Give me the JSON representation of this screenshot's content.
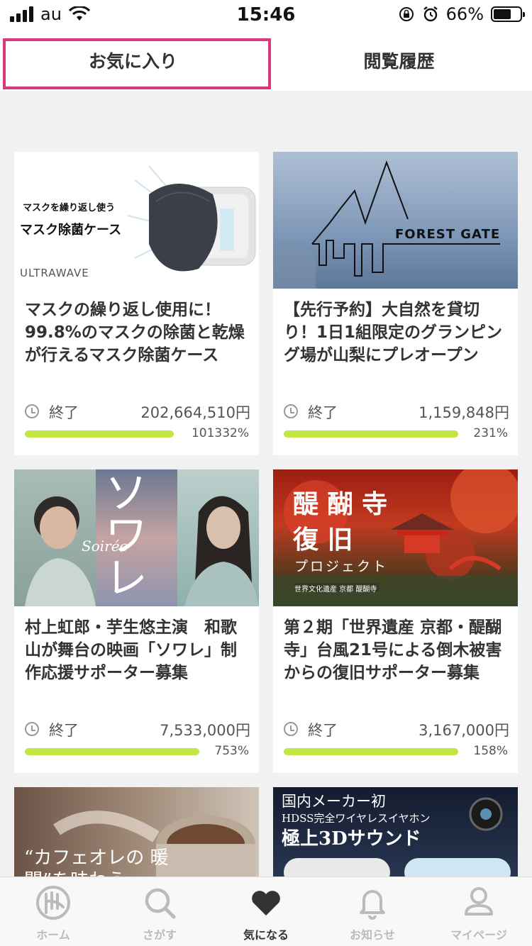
{
  "status_bar": {
    "carrier": "au",
    "time": "15:46",
    "battery": "66%"
  },
  "tabs": [
    {
      "label": "お気に入り",
      "active": true
    },
    {
      "label": "閲覧履歴",
      "active": false
    }
  ],
  "cards": [
    {
      "title": "マスクの繰り返し使用に！99.8%のマスクの除菌と乾燥が行えるマスク除菌ケース",
      "thumb": {
        "line1": "マスクを繰り返し使う",
        "line2": "マスク除菌ケース",
        "brand": "ULTRAWAVE"
      },
      "status": "終了",
      "amount": "202,664,510円",
      "percent": "101332%",
      "progress": 1.0
    },
    {
      "title": "【先行予約】大自然を貸切り！1日1組限定のグランピング場が山梨にプレオープン",
      "thumb": {
        "text": "FOREST GATE"
      },
      "status": "終了",
      "amount": "1,159,848円",
      "percent": "231%",
      "progress": 1.0
    },
    {
      "title": "村上虹郎・芋生悠主演　和歌山が舞台の映画「ソワレ」制作応援サポーター募集",
      "thumb": {
        "big": "ソワレ",
        "sub": "Soirée"
      },
      "status": "終了",
      "amount": "7,533,000円",
      "percent": "753%",
      "progress": 1.0
    },
    {
      "title": "第２期「世界遺産 京都・醍醐寺」台風21号による倒木被害からの復旧サポーター募集",
      "thumb": {
        "line1": "醍 醐 寺",
        "line2": "復 旧",
        "line3": "プロジェクト",
        "line4": "世界文化遺産 京都 醍醐寺"
      },
      "status": "終了",
      "amount": "3,167,000円",
      "percent": "158%",
      "progress": 1.0
    },
    {
      "thumb": {
        "text": "“カフェオレの 暖闇”を味わう"
      }
    },
    {
      "thumb": {
        "line1": "国内メーカー初",
        "line2": "HDSS完全ワイヤレスイヤホン",
        "line3": "極上3Dサウンド"
      }
    }
  ],
  "tabbar": [
    {
      "label": "ホーム",
      "icon": "home-icon",
      "active": false
    },
    {
      "label": "さがす",
      "icon": "search-icon",
      "active": false
    },
    {
      "label": "気になる",
      "icon": "heart-icon",
      "active": true
    },
    {
      "label": "お知らせ",
      "icon": "bell-icon",
      "active": false
    },
    {
      "label": "マイページ",
      "icon": "user-icon",
      "active": false
    }
  ],
  "colors": {
    "progress": "#c3e645",
    "highlight": "#d9397a",
    "background": "#f1f1f1"
  }
}
